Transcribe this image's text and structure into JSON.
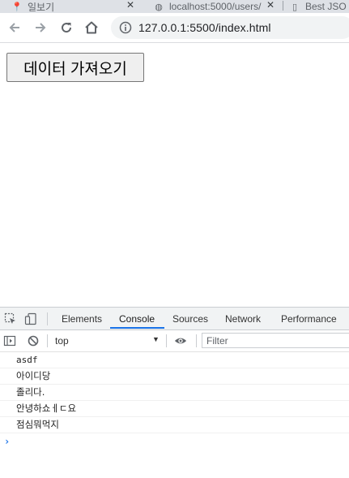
{
  "browser": {
    "tabs": [
      {
        "label": "일보기",
        "icon": "pin-icon"
      },
      {
        "label": "localhost:5000/users/",
        "icon": "globe-icon"
      },
      {
        "label": "Best JSO",
        "icon": "file-icon"
      }
    ],
    "url": "127.0.0.1:5500/index.html"
  },
  "page": {
    "fetch_button_label": "데이터 가져오기"
  },
  "devtools": {
    "tabs": [
      "Elements",
      "Console",
      "Sources",
      "Network",
      "Performance"
    ],
    "active_tab": "Console",
    "context": "top",
    "filter_placeholder": "Filter",
    "logs": [
      "asdf",
      "아이디당",
      "졸리다.",
      "안녕하쇼ㅔㄷ요",
      "점심뭐먹지"
    ],
    "prompt_symbol": "›"
  },
  "colors": {
    "accent": "#1a73e8",
    "tabstrip": "#dee1e6",
    "omnibox": "#f1f3f4"
  }
}
